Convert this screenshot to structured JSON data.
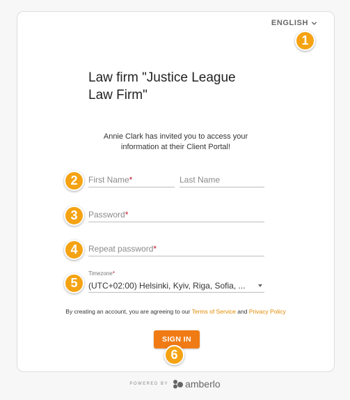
{
  "header": {
    "language": "ENGLISH"
  },
  "title": {
    "line1": "Law firm \"Justice League",
    "line2": "Law Firm\""
  },
  "invite_text": {
    "line1": "Annie Clark has invited you to access your",
    "line2": "information at their Client Portal!"
  },
  "fields": {
    "first_name": {
      "label": "First Name",
      "required": "*"
    },
    "last_name": {
      "label": "Last Name"
    },
    "password": {
      "label": "Password",
      "required": "*"
    },
    "repeat_password": {
      "label": "Repeat password",
      "required": "*"
    },
    "timezone": {
      "label": "Timezone",
      "required": "*",
      "value": "(UTC+02:00) Helsinki, Kyiv, Riga, Sofia, ..."
    }
  },
  "terms": {
    "prefix": "By creating an account, you are agreeing to our ",
    "terms_link": "Terms of Service",
    "and": " and ",
    "privacy_link": "Privacy Policy"
  },
  "sign_in_label": "SIGN IN",
  "badges": [
    "1",
    "2",
    "3",
    "4",
    "5",
    "6"
  ],
  "footer": {
    "powered_by": "POWERED BY",
    "brand": "amberlo"
  },
  "colors": {
    "accent": "#f07b15",
    "badge": "#f5a313",
    "link": "#e08a00",
    "required": "#c0152b"
  }
}
